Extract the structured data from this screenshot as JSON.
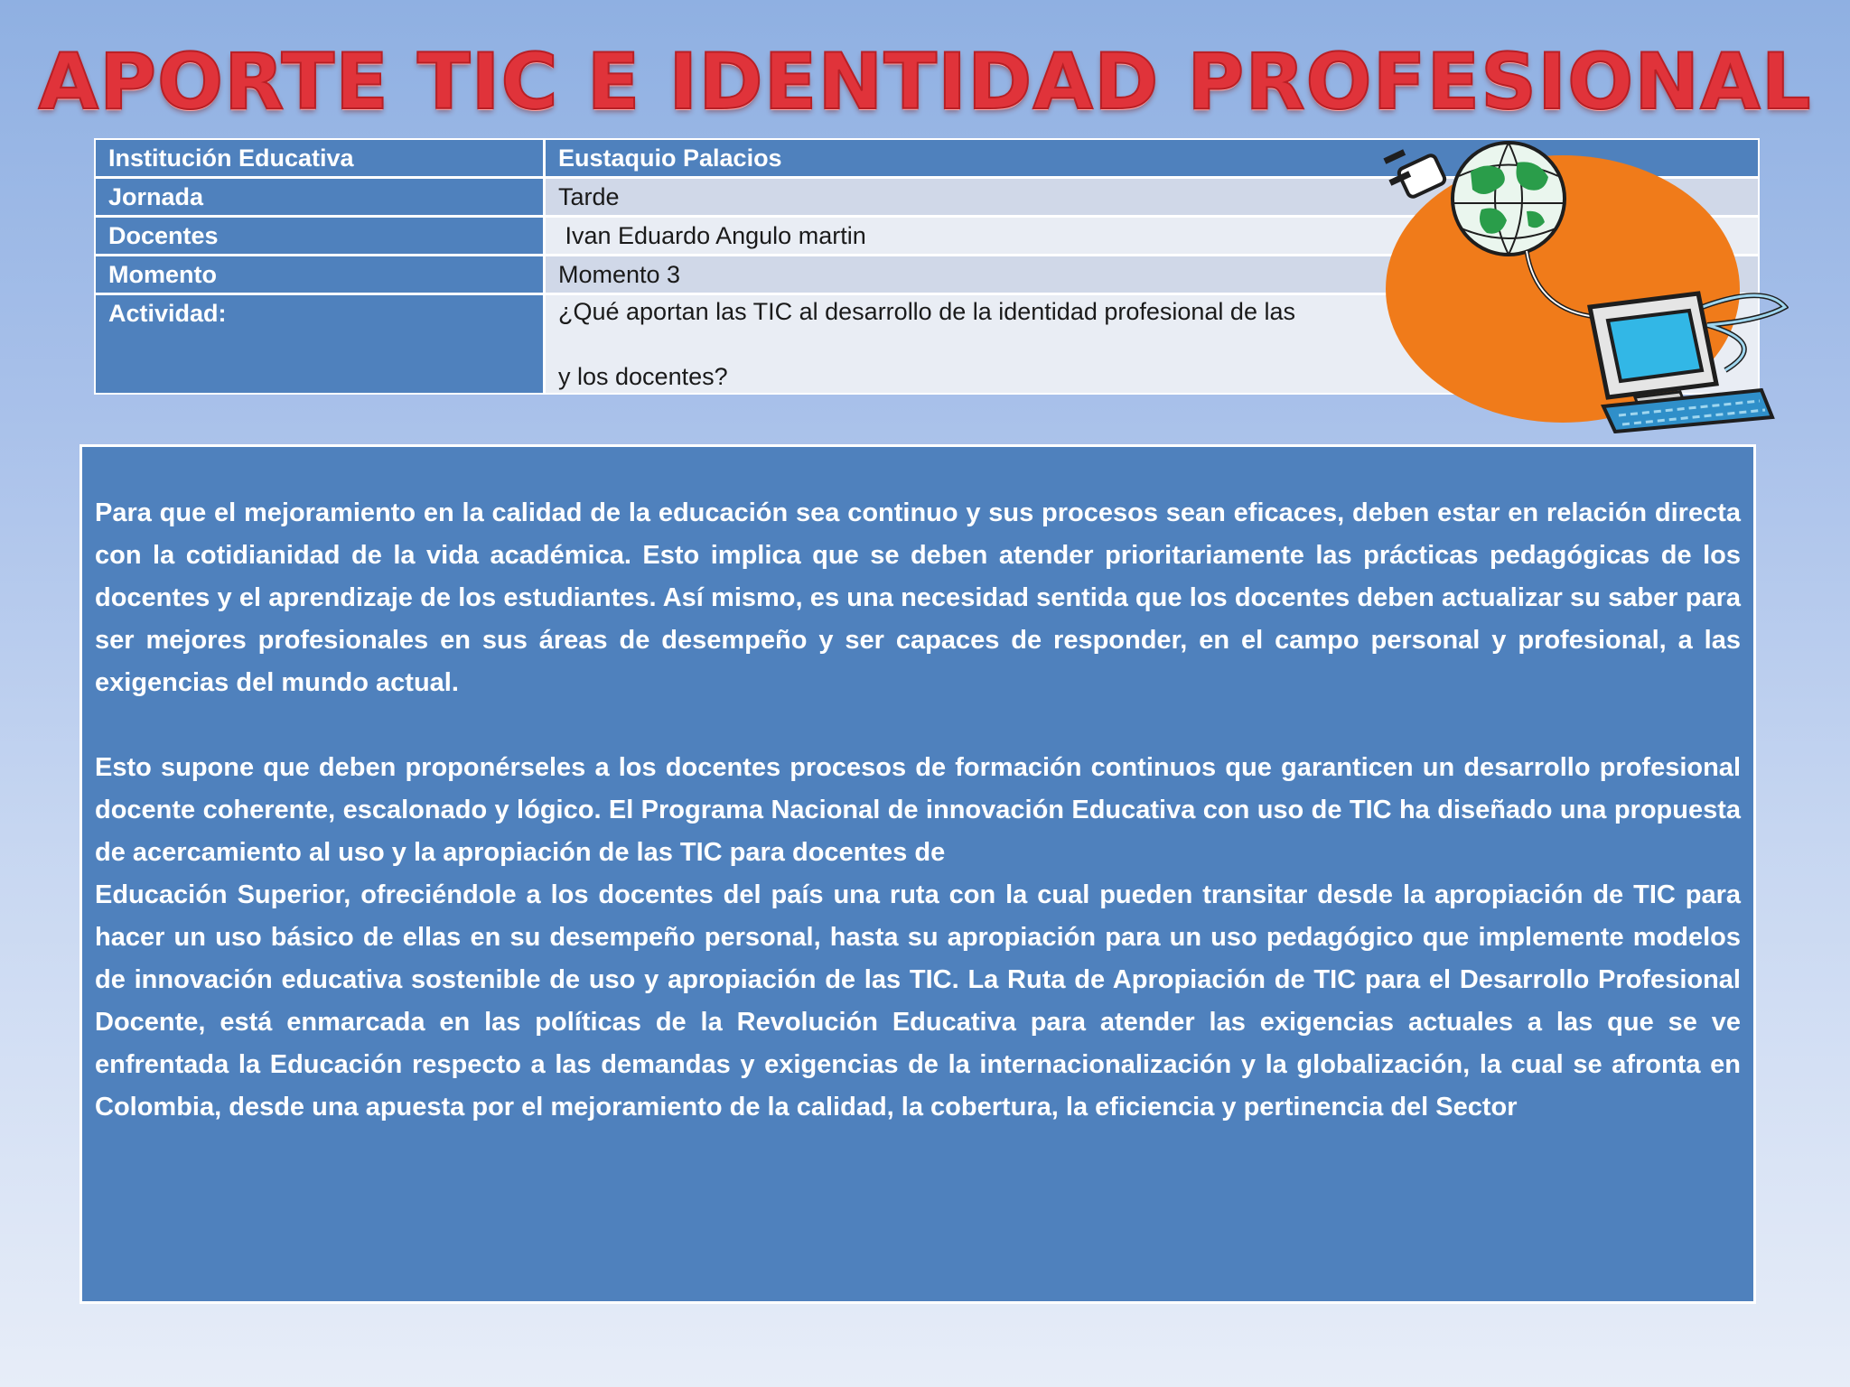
{
  "title": "APORTE TIC E IDENTIDAD PROFESIONAL",
  "info_table": {
    "rows": [
      {
        "label": "Institución Educativa",
        "value": "Eustaquio Palacios"
      },
      {
        "label": "Jornada",
        "value": "Tarde"
      },
      {
        "label": "Docentes",
        "value": " Ivan Eduardo Angulo martin"
      },
      {
        "label": "Momento",
        "value": "Momento 3"
      }
    ],
    "activity": {
      "label": "Actividad:",
      "line1": "¿Qué aportan las TIC al desarrollo de la identidad profesional de las",
      "line2": "y los docentes?"
    }
  },
  "clipart": {
    "icon": "globe-computer-icon",
    "colors": {
      "sun": "#f07b1a",
      "globe": "#2a9d4a",
      "screen": "#32b7e6",
      "keyboard": "#2f8fc9"
    }
  },
  "content": {
    "paragraph1": "Para que el mejoramiento en la calidad de la educación sea continuo y sus procesos sean eficaces, deben estar en relación directa con la cotidianidad de la vida académica. Esto implica que se deben atender prioritariamente las prácticas pedagógicas de los docentes y el aprendizaje de los estudiantes. Así mismo, es una necesidad sentida que los docentes deben actualizar su saber para ser mejores profesionales en sus áreas de desempeño y ser capaces de responder, en el campo personal y profesional, a las exigencias del mundo actual.",
    "paragraph2a": "Esto supone que deben proponérseles a los docentes procesos de formación continuos que garanticen un desarrollo profesional docente coherente, escalonado y lógico. El Programa Nacional de innovación Educativa con uso de TIC ha diseñado una propuesta de acercamiento al uso y la apropiación de las TIC para docentes de",
    "paragraph2b": "Educación Superior, ofreciéndole a los docentes del país una ruta con la cual pueden transitar desde la apropiación de TIC para hacer un uso básico de ellas en su desempeño personal, hasta su apropiación para un uso pedagógico que implemente modelos de innovación educativa sostenible de uso y apropiación de las TIC. La Ruta de Apropiación de TIC para el Desarrollo Profesional Docente, está enmarcada en las políticas de la Revolución Educativa para atender las exigencias actuales a las que se ve enfrentada la Educación respecto a las demandas y exigencias de la internacionalización y la globalización, la cual se afronta en Colombia, desde una  apuesta por el mejoramiento de la calidad, la cobertura, la eficiencia y pertinencia del Sector"
  }
}
